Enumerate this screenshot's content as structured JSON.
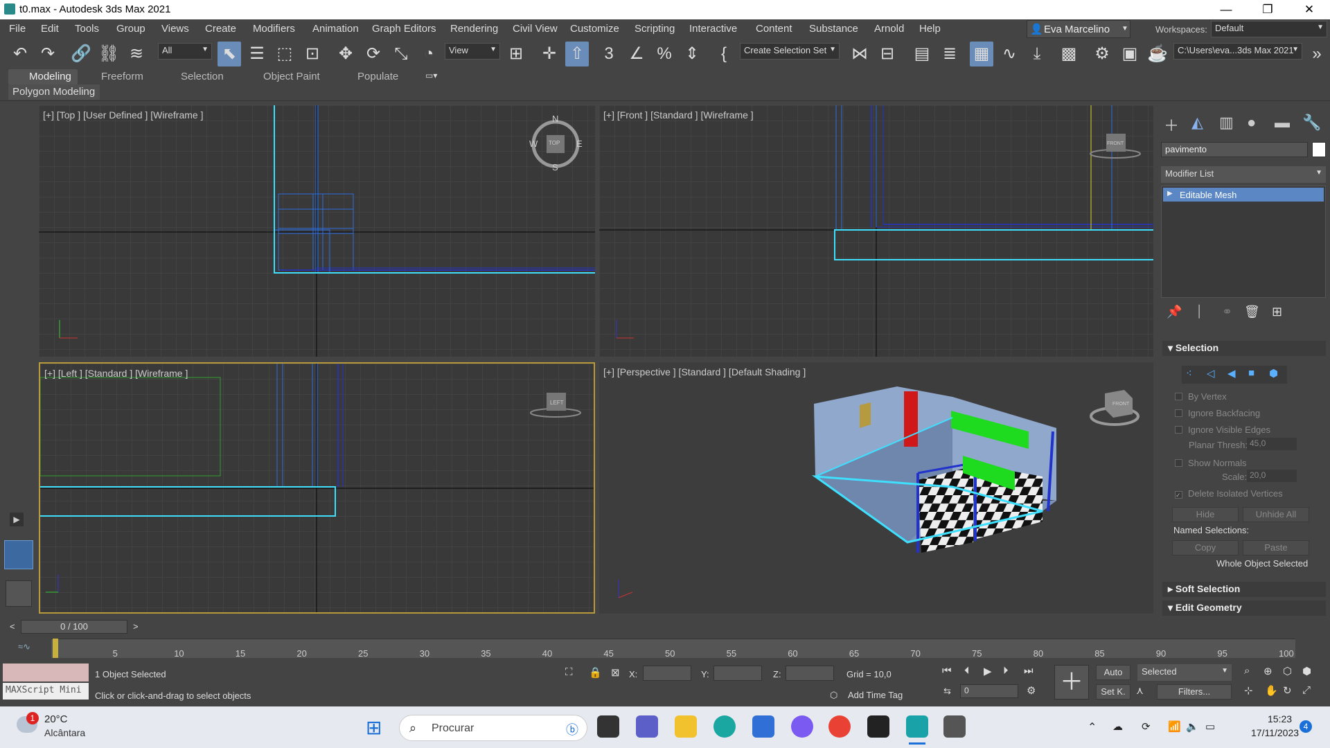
{
  "window": {
    "title": "t0.max - Autodesk 3ds Max 2021",
    "minimize": "—",
    "maximize": "❐",
    "close": "✕"
  },
  "menu": [
    "File",
    "Edit",
    "Tools",
    "Group",
    "Views",
    "Create",
    "Modifiers",
    "Animation",
    "Graph Editors",
    "Rendering",
    "Civil View",
    "Customize",
    "Scripting",
    "Interactive",
    "Content",
    "Substance",
    "Arnold",
    "Help"
  ],
  "user": {
    "name": "Eva Marcelino"
  },
  "workspaces": {
    "label": "Workspaces:",
    "value": "Default"
  },
  "toolbar": {
    "filter": "All",
    "ref_coord": "View",
    "selection_set": "Create Selection Set",
    "project_path": "C:\\Users\\eva...3ds Max 2021"
  },
  "ribbon": {
    "tabs": [
      "Modeling",
      "Freeform",
      "Selection",
      "Object Paint",
      "Populate"
    ],
    "sub": "Polygon Modeling"
  },
  "viewports": {
    "top": {
      "label": "[+] [Top ] [User Defined ] [Wireframe ]",
      "compass": {
        "n": "N",
        "s": "S",
        "e": "E",
        "w": "W",
        "cube": "TOP"
      }
    },
    "front": {
      "label": "[+] [Front ] [Standard ] [Wireframe ]",
      "cube": "FRONT"
    },
    "left": {
      "label": "[+] [Left ] [Standard ] [Wireframe ]",
      "cube": "LEFT"
    },
    "perspective": {
      "label": "[+] [Perspective ] [Standard ] [Default Shading ]",
      "cube": "FRONT"
    }
  },
  "command_panel": {
    "object_name": "pavimento",
    "modifier_list": "Modifier List",
    "stack": [
      "Editable Mesh"
    ],
    "selection": {
      "title": "Selection",
      "by_vertex": "By Vertex",
      "ignore_backfacing": "Ignore Backfacing",
      "ignore_visible_edges": "Ignore Visible Edges",
      "planar_thresh_label": "Planar Thresh:",
      "planar_thresh": "45,0",
      "show_normals": "Show Normals",
      "scale_label": "Scale:",
      "scale": "20,0",
      "delete_isolated": "Delete Isolated Vertices",
      "hide": "Hide",
      "unhide_all": "Unhide All",
      "named_selections": "Named Selections:",
      "copy": "Copy",
      "paste": "Paste",
      "status": "Whole Object Selected"
    },
    "soft_selection": "Soft Selection",
    "edit_geometry": "Edit Geometry"
  },
  "timeline": {
    "frame": "0 / 100",
    "ticks": [
      "5",
      "10",
      "15",
      "20",
      "25",
      "30",
      "35",
      "40",
      "45",
      "50",
      "55",
      "60",
      "65",
      "70",
      "75",
      "80",
      "85",
      "90",
      "95",
      "100"
    ]
  },
  "status": {
    "maxscript": "MAXScript Mini",
    "selected": "1 Object Selected",
    "prompt": "Click or click-and-drag to select objects",
    "x_label": "X:",
    "y_label": "Y:",
    "z_label": "Z:",
    "grid": "Grid = 10,0",
    "add_time_tag": "Add Time Tag",
    "auto": "Auto",
    "set_key": "Set K.",
    "key_filter": "Selected",
    "filters": "Filters...",
    "frame_value": "0"
  },
  "taskbar": {
    "weather_temp": "20°C",
    "weather_place": "Alcântara",
    "weather_badge": "1",
    "search": "Procurar",
    "time": "15:23",
    "date": "17/11/2023",
    "notif": "4"
  }
}
